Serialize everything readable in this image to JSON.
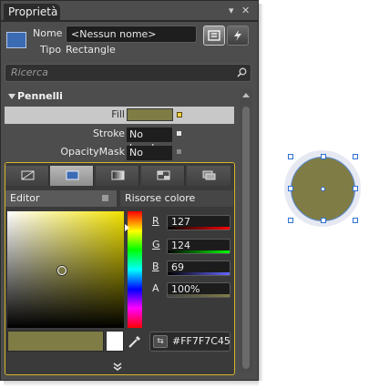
{
  "panel": {
    "tab_label": "Proprietà",
    "pin_icon": "pin-icon",
    "close_icon": "close-icon"
  },
  "object": {
    "name_label": "Nome",
    "name_value": "<Nessun nome>",
    "type_label": "Tipo",
    "type_value": "Rectangle"
  },
  "search": {
    "placeholder": "Ricerca"
  },
  "brushes": {
    "section_title": "Pennelli",
    "rows": [
      {
        "label": "Fill",
        "value": "",
        "color": "#7F7C45"
      },
      {
        "label": "Stroke",
        "value": "No brush"
      },
      {
        "label": "OpacityMask",
        "value": "No brush"
      }
    ]
  },
  "editor": {
    "tab_editor": "Editor",
    "tab_resources": "Risorse colore",
    "channels": [
      {
        "key": "R",
        "value": "127"
      },
      {
        "key": "G",
        "value": "124"
      },
      {
        "key": "B",
        "value": "69"
      },
      {
        "key": "A",
        "value": "100%"
      }
    ],
    "hex_value": "#FF7F7C45",
    "current_color": "#7F7C45"
  },
  "colors": {
    "accent_border": "#D8B52A",
    "selection_blue": "#2F6FD1"
  }
}
